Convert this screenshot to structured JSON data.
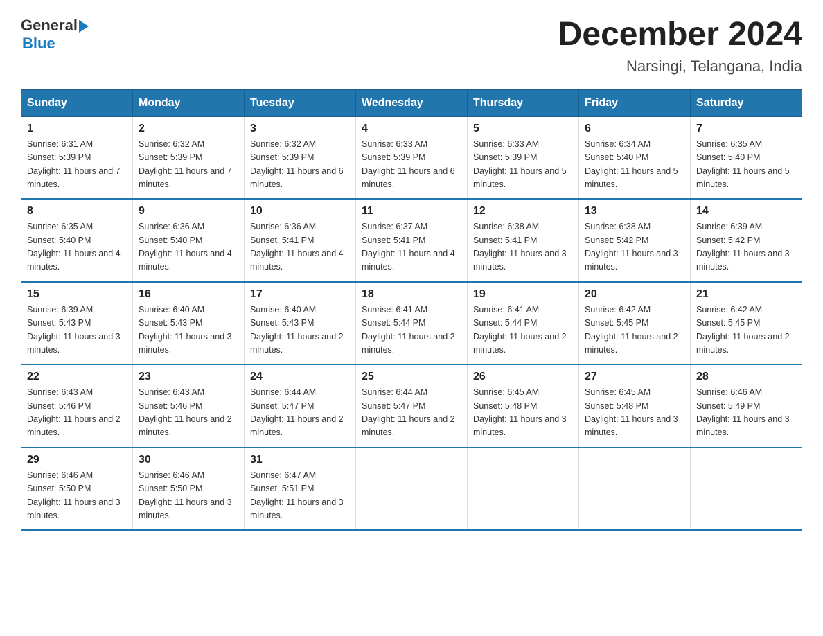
{
  "header": {
    "logo_general": "General",
    "logo_blue": "Blue",
    "title": "December 2024",
    "subtitle": "Narsingi, Telangana, India"
  },
  "days_header": [
    "Sunday",
    "Monday",
    "Tuesday",
    "Wednesday",
    "Thursday",
    "Friday",
    "Saturday"
  ],
  "weeks": [
    [
      {
        "day": "1",
        "sunrise": "Sunrise: 6:31 AM",
        "sunset": "Sunset: 5:39 PM",
        "daylight": "Daylight: 11 hours and 7 minutes."
      },
      {
        "day": "2",
        "sunrise": "Sunrise: 6:32 AM",
        "sunset": "Sunset: 5:39 PM",
        "daylight": "Daylight: 11 hours and 7 minutes."
      },
      {
        "day": "3",
        "sunrise": "Sunrise: 6:32 AM",
        "sunset": "Sunset: 5:39 PM",
        "daylight": "Daylight: 11 hours and 6 minutes."
      },
      {
        "day": "4",
        "sunrise": "Sunrise: 6:33 AM",
        "sunset": "Sunset: 5:39 PM",
        "daylight": "Daylight: 11 hours and 6 minutes."
      },
      {
        "day": "5",
        "sunrise": "Sunrise: 6:33 AM",
        "sunset": "Sunset: 5:39 PM",
        "daylight": "Daylight: 11 hours and 5 minutes."
      },
      {
        "day": "6",
        "sunrise": "Sunrise: 6:34 AM",
        "sunset": "Sunset: 5:40 PM",
        "daylight": "Daylight: 11 hours and 5 minutes."
      },
      {
        "day": "7",
        "sunrise": "Sunrise: 6:35 AM",
        "sunset": "Sunset: 5:40 PM",
        "daylight": "Daylight: 11 hours and 5 minutes."
      }
    ],
    [
      {
        "day": "8",
        "sunrise": "Sunrise: 6:35 AM",
        "sunset": "Sunset: 5:40 PM",
        "daylight": "Daylight: 11 hours and 4 minutes."
      },
      {
        "day": "9",
        "sunrise": "Sunrise: 6:36 AM",
        "sunset": "Sunset: 5:40 PM",
        "daylight": "Daylight: 11 hours and 4 minutes."
      },
      {
        "day": "10",
        "sunrise": "Sunrise: 6:36 AM",
        "sunset": "Sunset: 5:41 PM",
        "daylight": "Daylight: 11 hours and 4 minutes."
      },
      {
        "day": "11",
        "sunrise": "Sunrise: 6:37 AM",
        "sunset": "Sunset: 5:41 PM",
        "daylight": "Daylight: 11 hours and 4 minutes."
      },
      {
        "day": "12",
        "sunrise": "Sunrise: 6:38 AM",
        "sunset": "Sunset: 5:41 PM",
        "daylight": "Daylight: 11 hours and 3 minutes."
      },
      {
        "day": "13",
        "sunrise": "Sunrise: 6:38 AM",
        "sunset": "Sunset: 5:42 PM",
        "daylight": "Daylight: 11 hours and 3 minutes."
      },
      {
        "day": "14",
        "sunrise": "Sunrise: 6:39 AM",
        "sunset": "Sunset: 5:42 PM",
        "daylight": "Daylight: 11 hours and 3 minutes."
      }
    ],
    [
      {
        "day": "15",
        "sunrise": "Sunrise: 6:39 AM",
        "sunset": "Sunset: 5:43 PM",
        "daylight": "Daylight: 11 hours and 3 minutes."
      },
      {
        "day": "16",
        "sunrise": "Sunrise: 6:40 AM",
        "sunset": "Sunset: 5:43 PM",
        "daylight": "Daylight: 11 hours and 3 minutes."
      },
      {
        "day": "17",
        "sunrise": "Sunrise: 6:40 AM",
        "sunset": "Sunset: 5:43 PM",
        "daylight": "Daylight: 11 hours and 2 minutes."
      },
      {
        "day": "18",
        "sunrise": "Sunrise: 6:41 AM",
        "sunset": "Sunset: 5:44 PM",
        "daylight": "Daylight: 11 hours and 2 minutes."
      },
      {
        "day": "19",
        "sunrise": "Sunrise: 6:41 AM",
        "sunset": "Sunset: 5:44 PM",
        "daylight": "Daylight: 11 hours and 2 minutes."
      },
      {
        "day": "20",
        "sunrise": "Sunrise: 6:42 AM",
        "sunset": "Sunset: 5:45 PM",
        "daylight": "Daylight: 11 hours and 2 minutes."
      },
      {
        "day": "21",
        "sunrise": "Sunrise: 6:42 AM",
        "sunset": "Sunset: 5:45 PM",
        "daylight": "Daylight: 11 hours and 2 minutes."
      }
    ],
    [
      {
        "day": "22",
        "sunrise": "Sunrise: 6:43 AM",
        "sunset": "Sunset: 5:46 PM",
        "daylight": "Daylight: 11 hours and 2 minutes."
      },
      {
        "day": "23",
        "sunrise": "Sunrise: 6:43 AM",
        "sunset": "Sunset: 5:46 PM",
        "daylight": "Daylight: 11 hours and 2 minutes."
      },
      {
        "day": "24",
        "sunrise": "Sunrise: 6:44 AM",
        "sunset": "Sunset: 5:47 PM",
        "daylight": "Daylight: 11 hours and 2 minutes."
      },
      {
        "day": "25",
        "sunrise": "Sunrise: 6:44 AM",
        "sunset": "Sunset: 5:47 PM",
        "daylight": "Daylight: 11 hours and 2 minutes."
      },
      {
        "day": "26",
        "sunrise": "Sunrise: 6:45 AM",
        "sunset": "Sunset: 5:48 PM",
        "daylight": "Daylight: 11 hours and 3 minutes."
      },
      {
        "day": "27",
        "sunrise": "Sunrise: 6:45 AM",
        "sunset": "Sunset: 5:48 PM",
        "daylight": "Daylight: 11 hours and 3 minutes."
      },
      {
        "day": "28",
        "sunrise": "Sunrise: 6:46 AM",
        "sunset": "Sunset: 5:49 PM",
        "daylight": "Daylight: 11 hours and 3 minutes."
      }
    ],
    [
      {
        "day": "29",
        "sunrise": "Sunrise: 6:46 AM",
        "sunset": "Sunset: 5:50 PM",
        "daylight": "Daylight: 11 hours and 3 minutes."
      },
      {
        "day": "30",
        "sunrise": "Sunrise: 6:46 AM",
        "sunset": "Sunset: 5:50 PM",
        "daylight": "Daylight: 11 hours and 3 minutes."
      },
      {
        "day": "31",
        "sunrise": "Sunrise: 6:47 AM",
        "sunset": "Sunset: 5:51 PM",
        "daylight": "Daylight: 11 hours and 3 minutes."
      },
      null,
      null,
      null,
      null
    ]
  ]
}
